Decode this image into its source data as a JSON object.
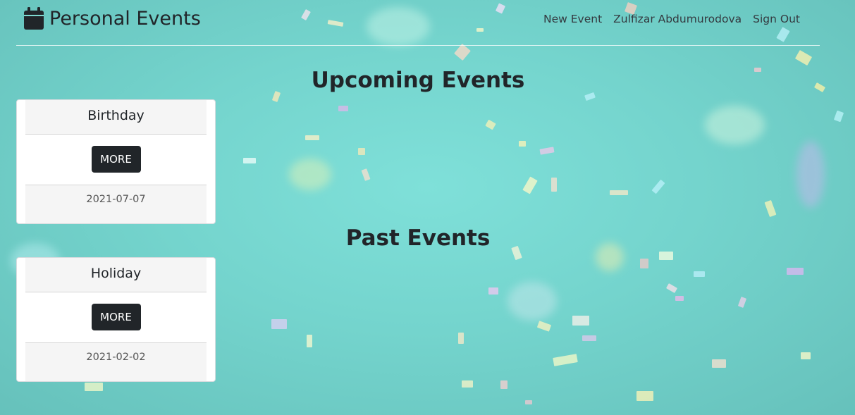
{
  "navbar": {
    "brand": "Personal Events",
    "links": [
      "New Event",
      "Zulfizar Abdumurodova",
      "Sign Out"
    ]
  },
  "sections": {
    "upcoming_title": "Upcoming Events",
    "past_title": "Past Events"
  },
  "events": [
    {
      "title": "Birthday",
      "button": "MORE",
      "date": "2021-07-07"
    },
    {
      "title": "Holiday",
      "button": "MORE",
      "date": "2021-02-02"
    }
  ],
  "colors": {
    "background": "#74d4cd",
    "button": "#212529",
    "text": "#212529"
  }
}
